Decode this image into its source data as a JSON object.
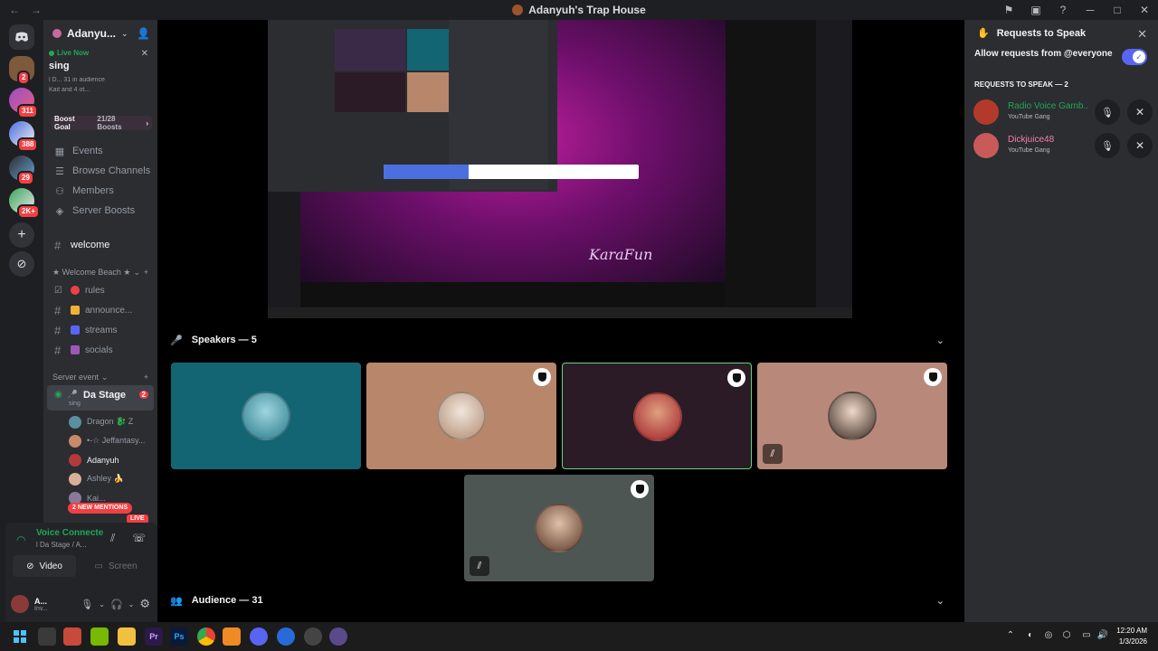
{
  "window": {
    "title": "Adanyuh's Trap House"
  },
  "rail": {
    "badges": [
      "2",
      "311",
      "388",
      "29",
      "2K+"
    ]
  },
  "sidebar": {
    "server_name": "Adanyuh's ...",
    "server_name_display": "Adanyu...",
    "live": {
      "label": "Live Now",
      "title": "sing",
      "meta1": "l D...  31 in audience",
      "meta2": "Kait  and 4 ot..."
    },
    "boost": {
      "label": "Boost Goal",
      "progress": "21/28 Boosts"
    },
    "nav": [
      {
        "label": "Events",
        "icon": "calendar-icon"
      },
      {
        "label": "Browse Channels",
        "icon": "browse-icon"
      },
      {
        "label": "Members",
        "icon": "members-icon"
      },
      {
        "label": "Server Boosts",
        "icon": "boost-icon"
      }
    ],
    "welcome_channel": "welcome",
    "category_welcome": "★ Welcome Beach ★",
    "channels": [
      {
        "label": "rules",
        "color": "#f23f43"
      },
      {
        "label": "announce...",
        "color": "#f0b232"
      },
      {
        "label": "streams",
        "color": "#5865f2"
      },
      {
        "label": "socials",
        "color": "#9b59b6"
      }
    ],
    "category_event": "Server event",
    "stage": {
      "name": "Da Stage",
      "sub": "sing",
      "badge": "2"
    },
    "members": [
      "Dragon 🐉 Z",
      "•-☆ Jeffantasy...",
      "Adanyuh",
      "Ashley 🍌",
      "Kai..."
    ],
    "mentions_pill": "2 NEW MENTIONS",
    "live_pill": "LIVE"
  },
  "voice": {
    "status": "Voice Connected",
    "status_display": "Voice Connecte",
    "channel": "l Da Stage / A...",
    "video_label": "Video",
    "screen_label": "Screen",
    "user_name": "A...",
    "user_status": "Inv..."
  },
  "stage": {
    "speakers_header": "Speakers — 5",
    "audience_header": "Audience — 31",
    "screenshare_watermark": "KaraFun",
    "tiles": [
      {
        "name": "speaker-1",
        "color": "#136574",
        "avatar": "#4aa3b5",
        "mod": false,
        "muted": false
      },
      {
        "name": "speaker-2",
        "color": "#b8876b",
        "avatar": "#e8dcd2",
        "mod": true,
        "muted": false
      },
      {
        "name": "speaker-3",
        "color": "#2b1b26",
        "avatar": "#c9303a",
        "mod": true,
        "muted": false
      },
      {
        "name": "speaker-4",
        "color": "#b8897a",
        "avatar": "#e8cfc0",
        "mod": true,
        "muted": true
      },
      {
        "name": "speaker-5",
        "color": "#4e5653",
        "avatar": "#c7a48f",
        "mod": true,
        "muted": true
      }
    ]
  },
  "requests": {
    "title": "Requests to Speak",
    "allow_label": "Allow requests from @everyone",
    "section": "REQUESTS TO SPEAK — 2",
    "items": [
      {
        "name": "Radio Voice Gamb...",
        "role": "YouTube Gang",
        "name_color": "#23a55a",
        "avatar": "#b33a2a"
      },
      {
        "name": "Dickjuice48",
        "role": "YouTube Gang",
        "name_color": "#f47fa8",
        "avatar": "#c85a5a"
      }
    ]
  },
  "taskbar": {
    "time": "12:20 AM",
    "date": "1/3/2026"
  },
  "colors": {
    "accent": "#5865f2",
    "online": "#23a55a",
    "danger": "#f23f43"
  }
}
